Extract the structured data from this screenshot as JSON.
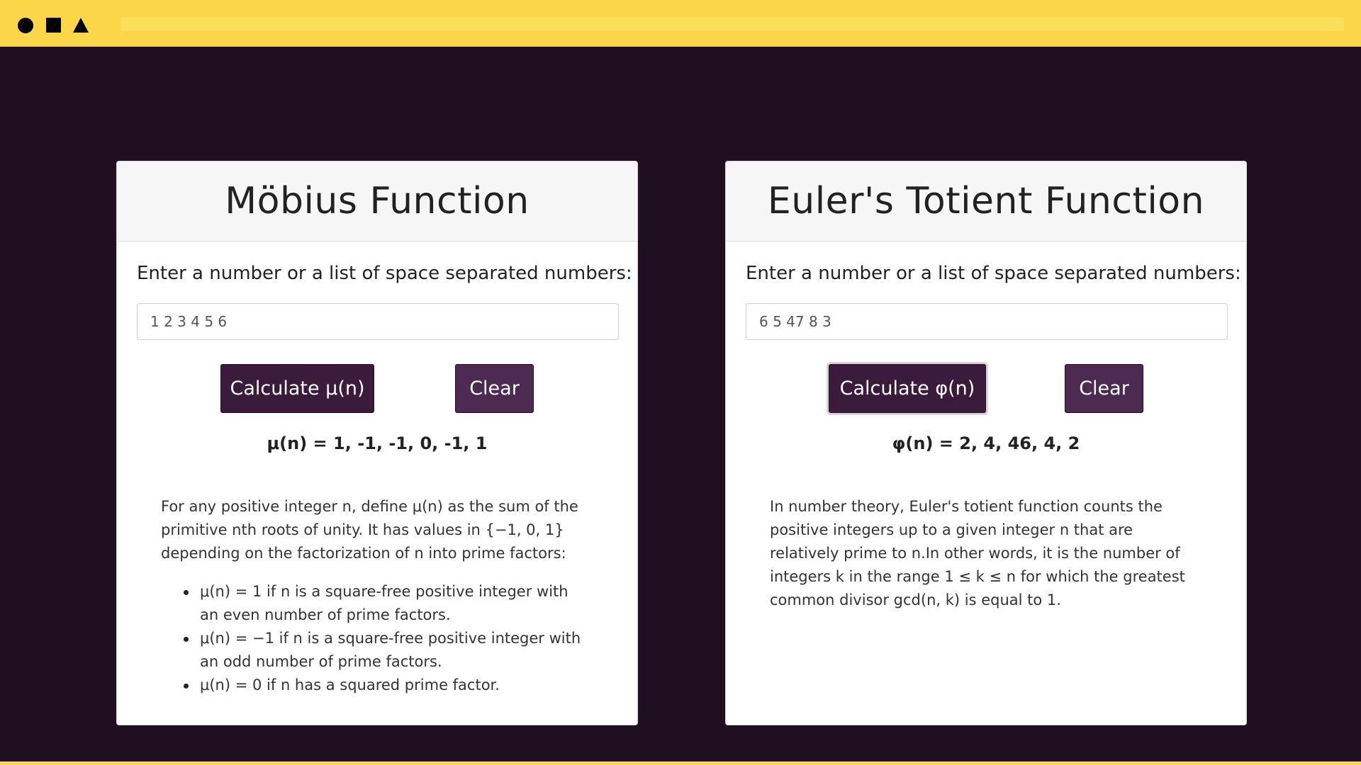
{
  "window": {
    "controls": [
      "circle",
      "square",
      "triangle"
    ]
  },
  "mobius": {
    "title": "Möbius Function",
    "prompt": "Enter a number or a list of space separated numbers:",
    "input_value": "1 2 3 4 5 6",
    "calc_label": "Calculate μ(n)",
    "clear_label": "Clear",
    "result": "μ(n) = 1, -1, -1, 0, -1, 1",
    "description": "For any positive integer n, define μ(n) as the sum of the primitive nth roots of unity. It has values in {−1, 0, 1} depending on the factorization of n into prime factors:",
    "rules": [
      "μ(n) = 1 if n is a square-free positive integer with an even number of prime factors.",
      "μ(n) = −1 if n is a square-free positive integer with an odd number of prime factors.",
      "μ(n) = 0 if n has a squared prime factor."
    ]
  },
  "totient": {
    "title": "Euler's Totient Function",
    "prompt": "Enter a number or a list of space separated numbers:",
    "input_value": "6 5 47 8 3",
    "calc_label": "Calculate φ(n)",
    "clear_label": "Clear",
    "result": "φ(n) = 2, 4, 46, 4, 2",
    "description": "In number theory, Euler's totient function counts the positive integers up to a given integer n that are relatively prime to n.In other words, it is the number of integers k in the range 1 ≤ k ≤ n for which the greatest common divisor gcd(n, k) is equal to 1."
  },
  "colors": {
    "top_bar": "#fbd648",
    "background": "#200f21",
    "button_primary": "#3a1b3c",
    "button_secondary": "#4d2a52"
  }
}
